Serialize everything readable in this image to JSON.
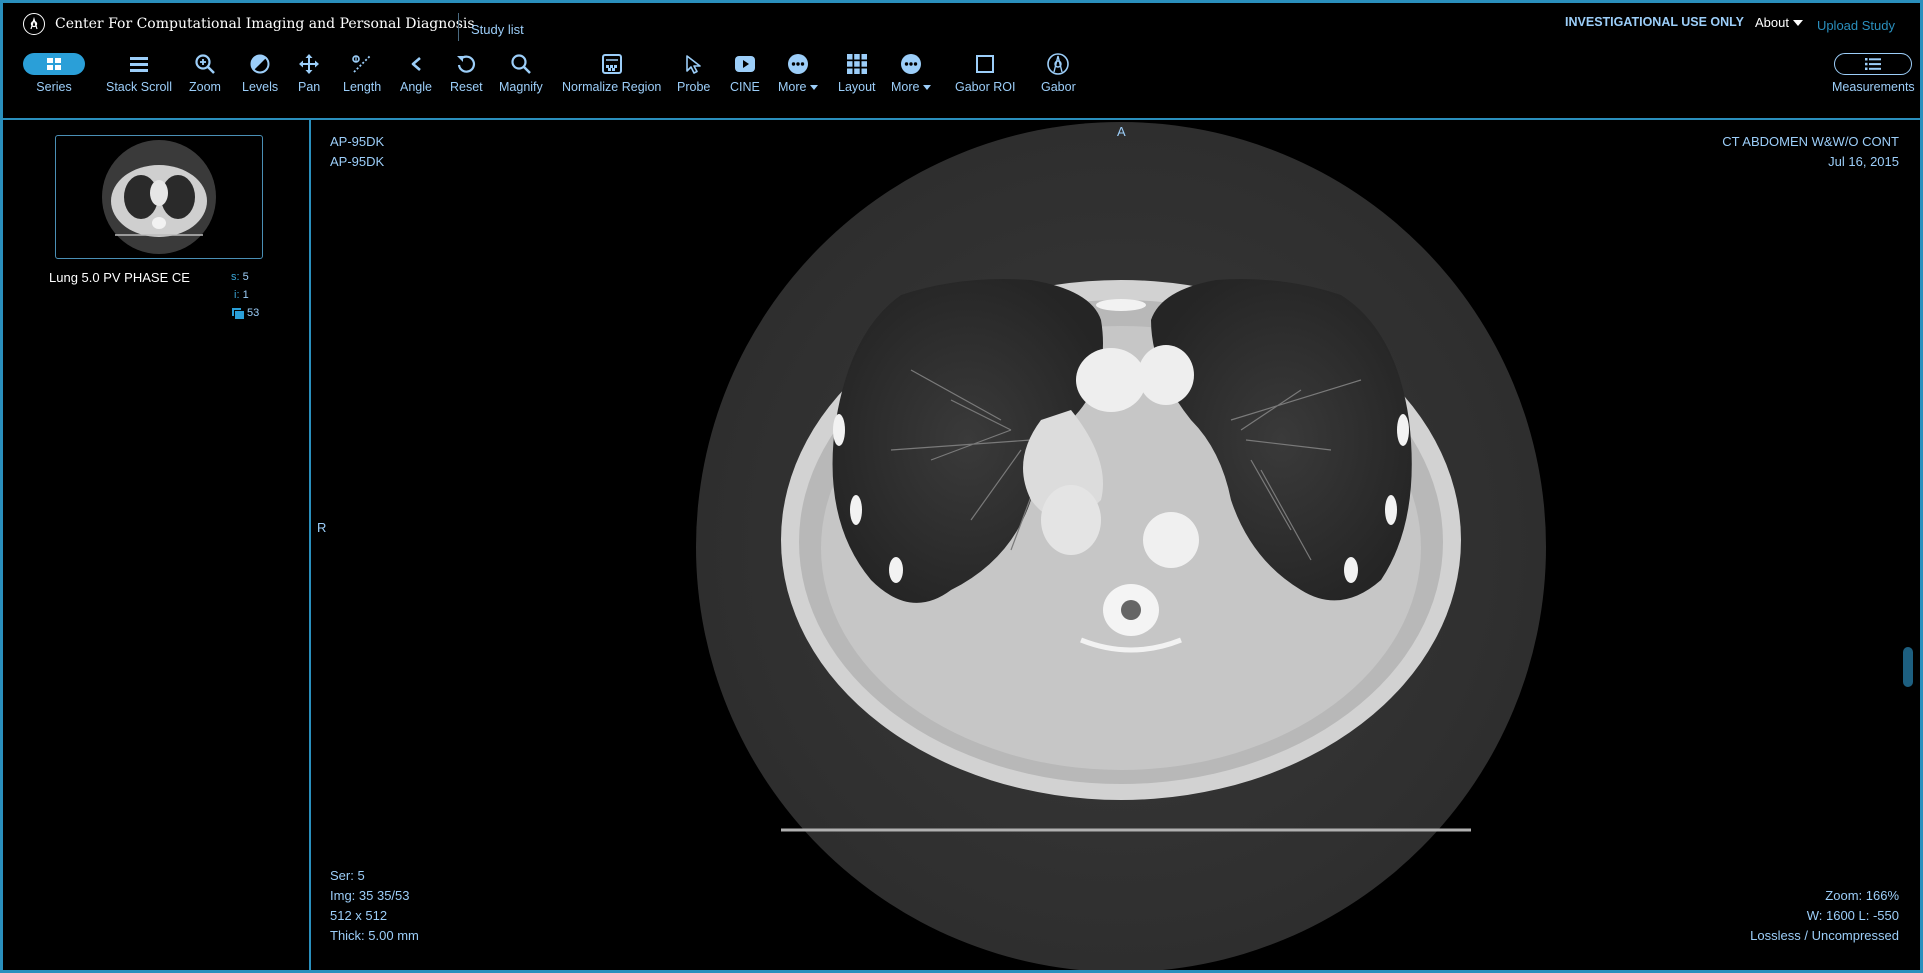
{
  "header": {
    "app_title": "Center For Computational Imaging and Personal Diagnosis",
    "study_list": "Study list",
    "investigational": "INVESTIGATIONAL USE ONLY",
    "about": "About",
    "upload": "Upload Study"
  },
  "toolbar": [
    {
      "label": "Series",
      "icon": "series-grid-icon"
    },
    {
      "label": "Stack Scroll",
      "icon": "stack-scroll-icon"
    },
    {
      "label": "Zoom",
      "icon": "zoom-icon"
    },
    {
      "label": "Levels",
      "icon": "levels-icon"
    },
    {
      "label": "Pan",
      "icon": "pan-icon"
    },
    {
      "label": "Length",
      "icon": "length-icon"
    },
    {
      "label": "Angle",
      "icon": "angle-icon"
    },
    {
      "label": "Reset",
      "icon": "reset-icon"
    },
    {
      "label": "Magnify",
      "icon": "magnify-icon"
    },
    {
      "label": "Normalize Region",
      "icon": "normalize-region-icon"
    },
    {
      "label": "Probe",
      "icon": "probe-icon"
    },
    {
      "label": "CINE",
      "icon": "cine-icon"
    },
    {
      "label": "More",
      "icon": "more-icon"
    },
    {
      "label": "Layout",
      "icon": "layout-icon"
    },
    {
      "label": "More",
      "icon": "more-icon"
    },
    {
      "label": "Gabor ROI",
      "icon": "gabor-roi-icon"
    },
    {
      "label": "Gabor",
      "icon": "gabor-icon"
    },
    {
      "label": "Measurements",
      "icon": "measurements-list-icon"
    }
  ],
  "series_panel": {
    "description": "Lung 5.0 PV PHASE CE",
    "s_key": "s:",
    "s_val": "5",
    "i_key": "i:",
    "i_val": "1",
    "count": "53"
  },
  "viewport": {
    "top_left": [
      "AP-95DK",
      "AP-95DK"
    ],
    "top_right": [
      "CT ABDOMEN W&W/O CONT",
      "Jul 16, 2015"
    ],
    "bottom_left": [
      "Ser: 5",
      "Img: 35 35/53",
      "512 x 512",
      "Thick: 5.00 mm"
    ],
    "bottom_right": [
      "Zoom: 166%",
      "W: 1600 L: -550",
      "Lossless / Uncompressed"
    ],
    "orient_top": "A",
    "orient_left": "R"
  },
  "colors": {
    "accent": "#2a8fbd",
    "text": "#9ccef9",
    "active_pill": "#2a9fd8"
  }
}
